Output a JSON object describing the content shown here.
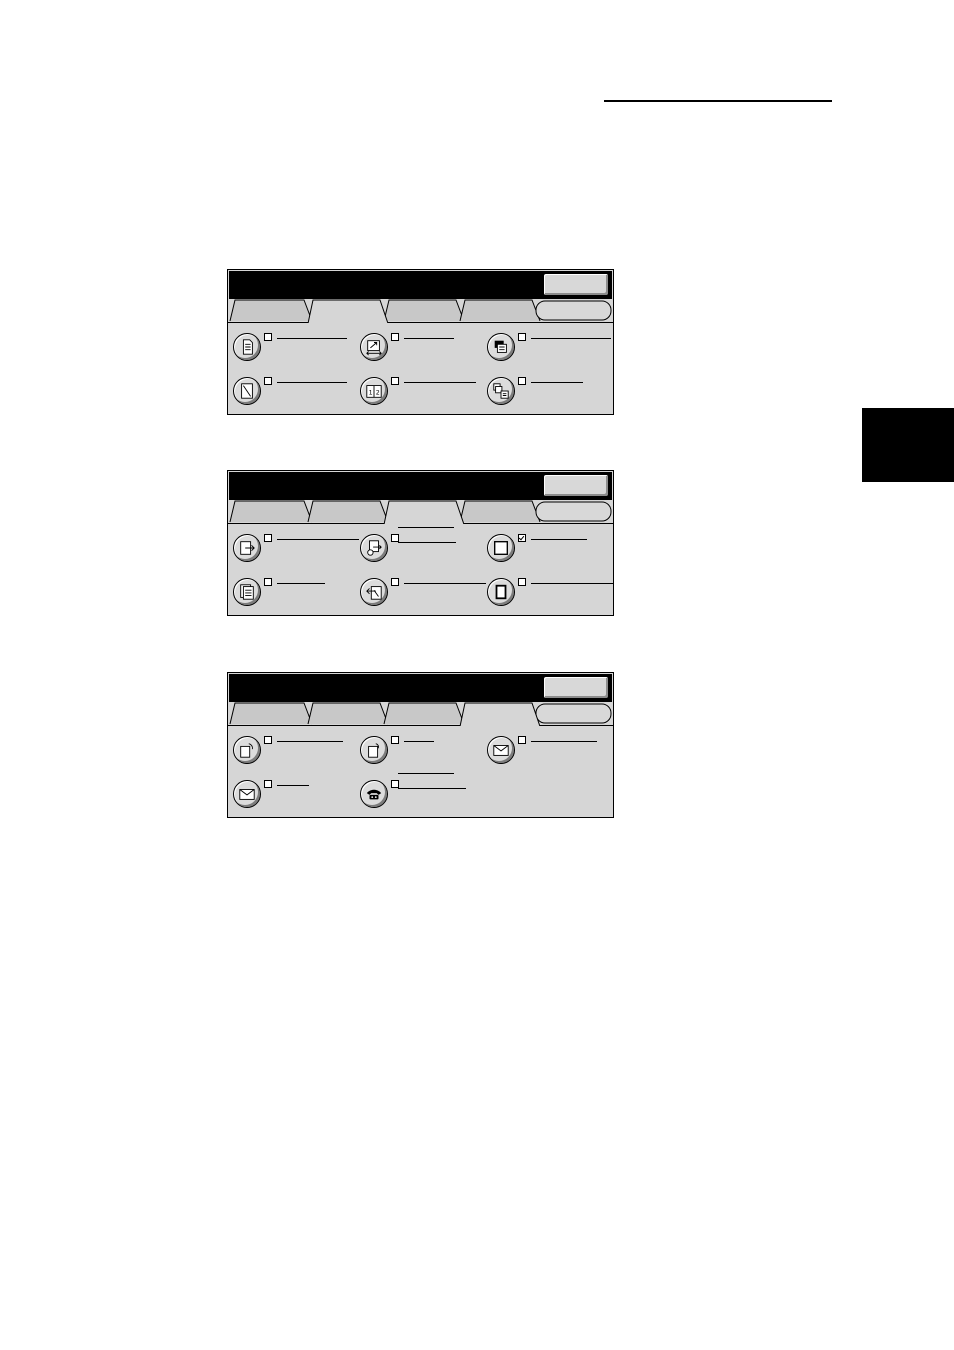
{
  "page": {
    "header_rule": true,
    "chapter_tab": true
  },
  "panels": [
    {
      "title": "",
      "close_label": "",
      "tabs": [
        {
          "label": "",
          "active": false
        },
        {
          "label": "",
          "active": true
        },
        {
          "label": "",
          "active": false
        },
        {
          "label": "",
          "active": false
        },
        {
          "label": "",
          "active": false
        }
      ],
      "features": [
        {
          "icon": "document-icon",
          "label": "",
          "checked": false
        },
        {
          "icon": "resize-icon",
          "label": "",
          "checked": false
        },
        {
          "icon": "stack-icon",
          "label": "",
          "checked": false
        },
        {
          "icon": "page-frame-icon",
          "label": "",
          "checked": false
        },
        {
          "icon": "book-pages-icon",
          "label": "",
          "checked": false
        },
        {
          "icon": "collate-icon",
          "label": "",
          "checked": false
        }
      ]
    },
    {
      "title": "",
      "close_label": "",
      "tabs": [
        {
          "label": "",
          "active": false
        },
        {
          "label": "",
          "active": false
        },
        {
          "label": "",
          "active": true
        },
        {
          "label": "",
          "active": false
        },
        {
          "label": "",
          "active": false
        }
      ],
      "features": [
        {
          "icon": "send-out-icon",
          "label": "",
          "checked": false
        },
        {
          "icon": "transfer-icon",
          "label": "",
          "checked": false
        },
        {
          "icon": "blank-page-icon",
          "label": "",
          "checked": true
        },
        {
          "icon": "multi-page-icon",
          "label": "",
          "checked": false
        },
        {
          "icon": "receive-in-icon",
          "label": "",
          "checked": false
        },
        {
          "icon": "bound-page-icon",
          "label": "",
          "checked": false
        }
      ]
    },
    {
      "title": "",
      "close_label": "",
      "tabs": [
        {
          "label": "",
          "active": false
        },
        {
          "label": "",
          "active": false
        },
        {
          "label": "",
          "active": false
        },
        {
          "label": "",
          "active": true
        },
        {
          "label": "",
          "active": false
        }
      ],
      "features": [
        {
          "icon": "phone-page-icon",
          "label": "",
          "checked": false
        },
        {
          "icon": "phone-page-small-icon",
          "label": "",
          "checked": false
        },
        {
          "icon": "mail-icon",
          "label": "",
          "checked": false
        },
        {
          "icon": "mail-icon",
          "label": "",
          "checked": false
        },
        {
          "icon": "telephone-icon",
          "label": "",
          "checked": false
        }
      ]
    }
  ]
}
